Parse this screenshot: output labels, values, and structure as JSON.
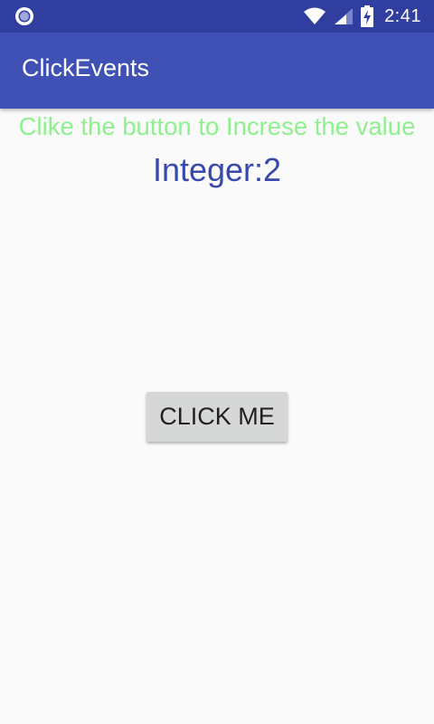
{
  "status_bar": {
    "time": "2:41",
    "icons": [
      "notification-circle-icon",
      "wifi-icon",
      "cell-signal-icon",
      "battery-charging-icon"
    ]
  },
  "app_bar": {
    "title": "ClickEvents"
  },
  "main": {
    "hint_text": "Clike the button to Increse the value",
    "integer_text": "Integer:2",
    "button_label": "CLICK ME"
  },
  "colors": {
    "status_bar": "#303f9f",
    "app_bar": "#3f51b5",
    "hint_text": "#90f090",
    "integer_text": "#3949ab",
    "button_bg": "#d6d7d7",
    "background": "#fafafa"
  }
}
